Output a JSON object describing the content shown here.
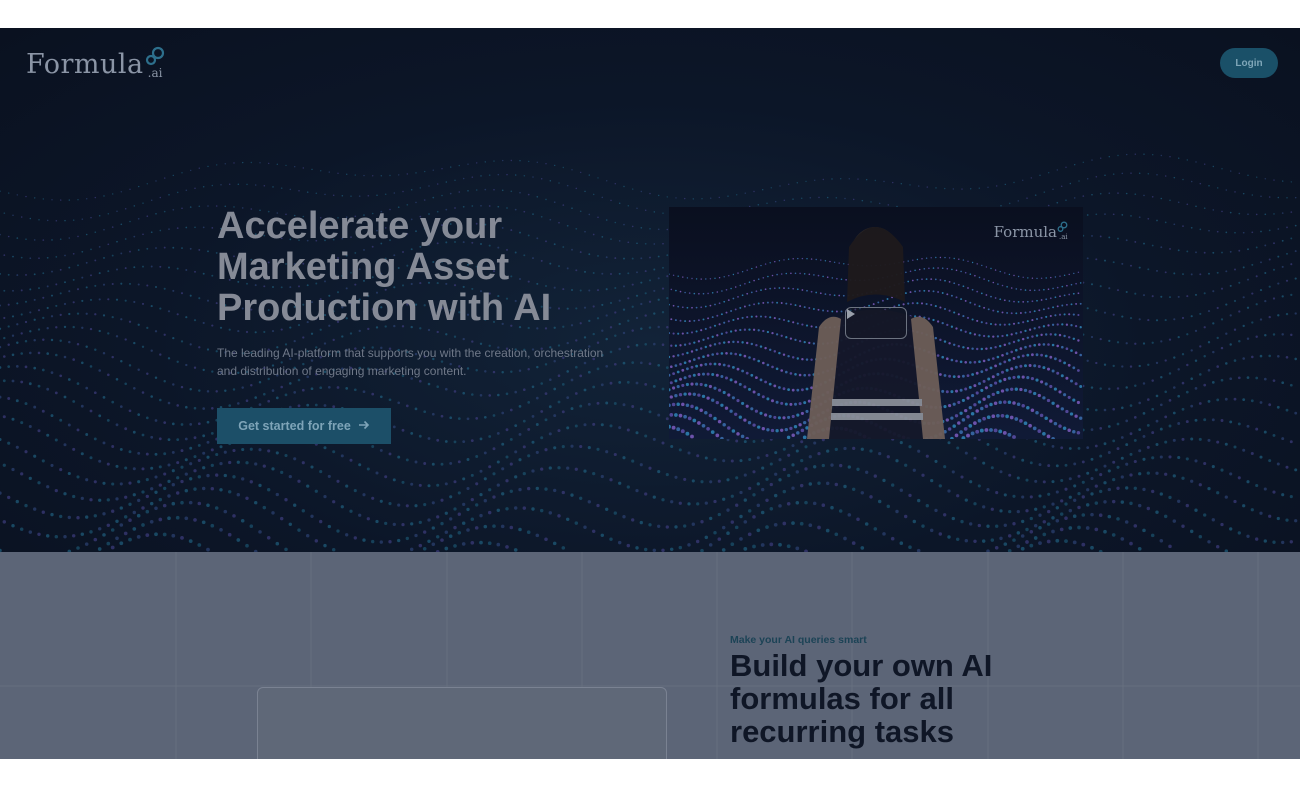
{
  "header": {
    "logo_text": "Formula",
    "logo_suffix": ".ai",
    "login_label": "Login"
  },
  "hero": {
    "headline": "Accelerate your Marketing Asset Production with AI",
    "subtext": "The leading AI-platform that supports you with the creation, orchestration and distribution of engaging marketing content.",
    "cta_label": "Get started for free",
    "cta_icon": "arrow-right-icon"
  },
  "video": {
    "logo_text": "Formula",
    "logo_suffix": ".ai",
    "play_icon": "play-icon"
  },
  "section2": {
    "eyebrow": "Make your AI queries smart",
    "title": "Build your own AI formulas for all recurring tasks"
  },
  "colors": {
    "hero_bg": "#0c1628",
    "accent": "#1c4f68",
    "section2_bg": "#5c6577"
  }
}
